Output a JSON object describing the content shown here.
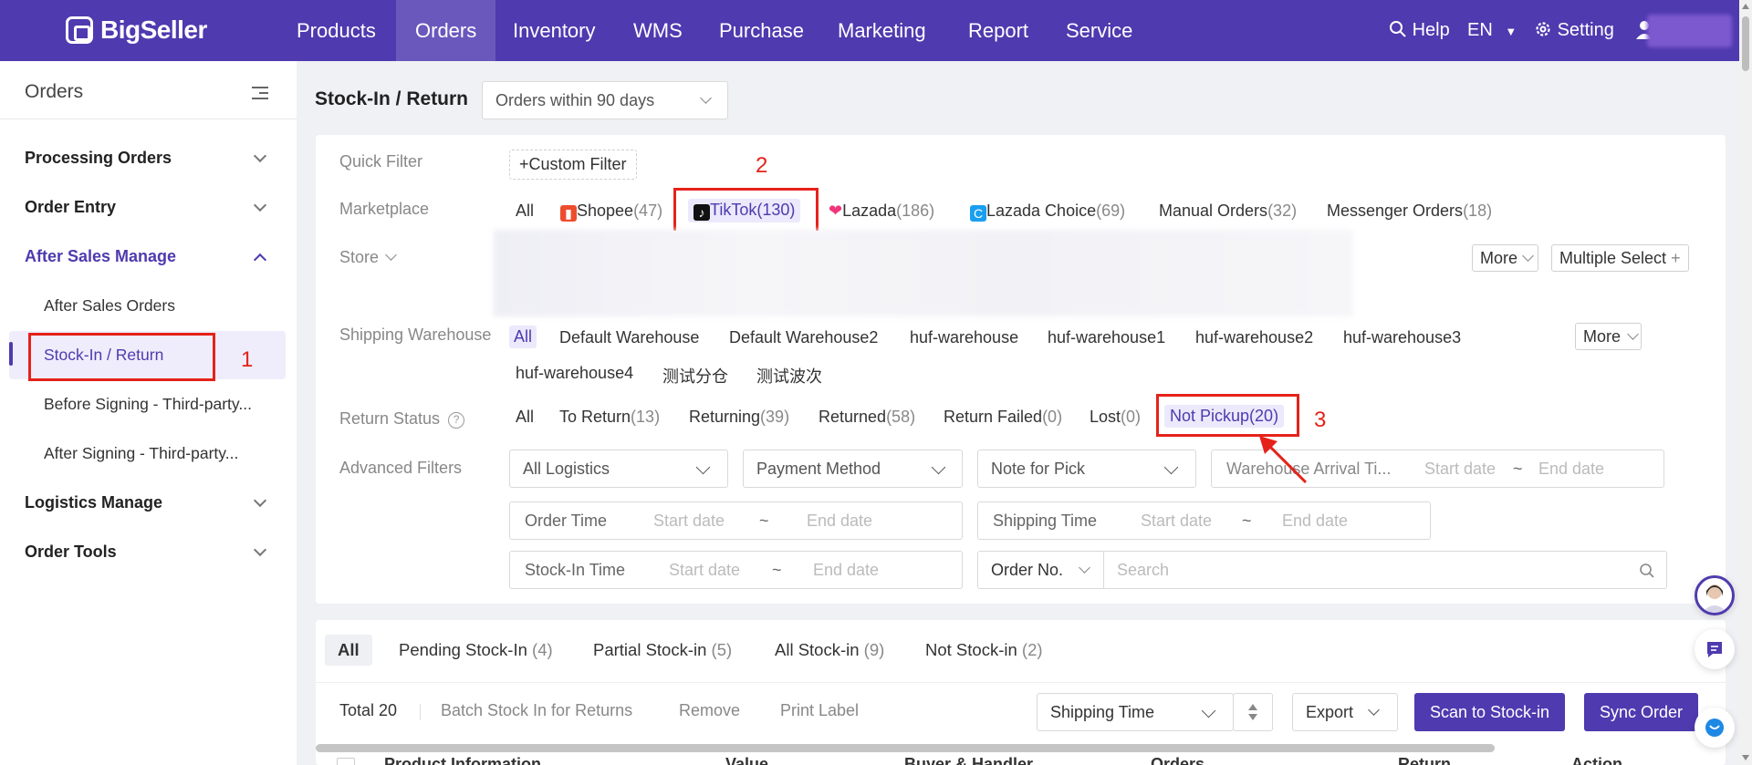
{
  "brand": "BigSeller",
  "nav": {
    "items": [
      "Products",
      "Orders",
      "Inventory",
      "WMS",
      "Purchase",
      "Marketing",
      "Report",
      "Service"
    ],
    "help": "Help",
    "lang": "EN",
    "setting": "Setting"
  },
  "sidebar": {
    "title": "Orders",
    "groups": [
      "Processing Orders",
      "Order Entry",
      "After Sales Manage",
      "Logistics Manage",
      "Order Tools"
    ],
    "after_sales": [
      "After Sales Orders",
      "Stock-In / Return",
      "Before Signing - Third-party...",
      "After Signing - Third-party..."
    ]
  },
  "annotations": [
    "1",
    "2",
    "3"
  ],
  "page": {
    "title": "Stock-In / Return",
    "period": "Orders within 90 days"
  },
  "filters": {
    "quick_label": "Quick Filter",
    "custom_filter": "Custom Filter",
    "marketplace_label": "Marketplace",
    "marketplaces": [
      {
        "name": "All",
        "count": ""
      },
      {
        "name": "Shopee",
        "count": "(47)"
      },
      {
        "name": "TikTok",
        "count": "(130)"
      },
      {
        "name": "Lazada",
        "count": "(186)"
      },
      {
        "name": "Lazada Choice",
        "count": "(69)"
      },
      {
        "name": "Manual Orders",
        "count": "(32)"
      },
      {
        "name": "Messenger Orders",
        "count": "(18)"
      }
    ],
    "store_label": "Store",
    "more": "More",
    "multiple_select": "Multiple Select",
    "warehouse_label": "Shipping Warehouse",
    "warehouses": [
      "All",
      "Default Warehouse",
      "Default Warehouse2",
      "huf-warehouse",
      "huf-warehouse1",
      "huf-warehouse2",
      "huf-warehouse3",
      "huf-warehouse4",
      "测试分仓",
      "测试波次"
    ],
    "return_status_label": "Return Status",
    "return_status": [
      {
        "name": "All",
        "count": ""
      },
      {
        "name": "To Return",
        "count": "(13)"
      },
      {
        "name": "Returning",
        "count": "(39)"
      },
      {
        "name": "Returned",
        "count": "(58)"
      },
      {
        "name": "Return Failed",
        "count": "(0)"
      },
      {
        "name": "Lost",
        "count": "(0)"
      },
      {
        "name": "Not Pickup",
        "count": "(20)"
      }
    ],
    "advanced_label": "Advanced Filters",
    "all_logistics": "All Logistics",
    "payment_method": "Payment Method",
    "note_for_pick": "Note for Pick",
    "warehouse_arrival": "Warehouse Arrival Ti...",
    "order_time": "Order Time",
    "shipping_time": "Shipping Time",
    "stock_in_time": "Stock-In Time",
    "start_date": "Start date",
    "end_date": "End date",
    "tilde": "~",
    "order_no": "Order No.",
    "search_placeholder": "Search"
  },
  "tabs": [
    {
      "name": "All",
      "count": ""
    },
    {
      "name": "Pending Stock-In ",
      "count": "(4)"
    },
    {
      "name": "Partial Stock-in ",
      "count": "(5)"
    },
    {
      "name": "All Stock-in ",
      "count": "(9)"
    },
    {
      "name": "Not Stock-in ",
      "count": "(2)"
    }
  ],
  "toolbar": {
    "total": "Total 20",
    "batch": "Batch Stock In for Returns",
    "remove": "Remove",
    "print": "Print Label",
    "sort": "Shipping Time",
    "export": "Export",
    "scan": "Scan to Stock-in",
    "sync": "Sync Order"
  },
  "table_headers": [
    "Product Information",
    "Value",
    "Buyer & Handler",
    "Orders",
    "Return",
    "Action"
  ],
  "colors": {
    "brand": "#4f3aaf",
    "annotation": "#e5221a"
  }
}
